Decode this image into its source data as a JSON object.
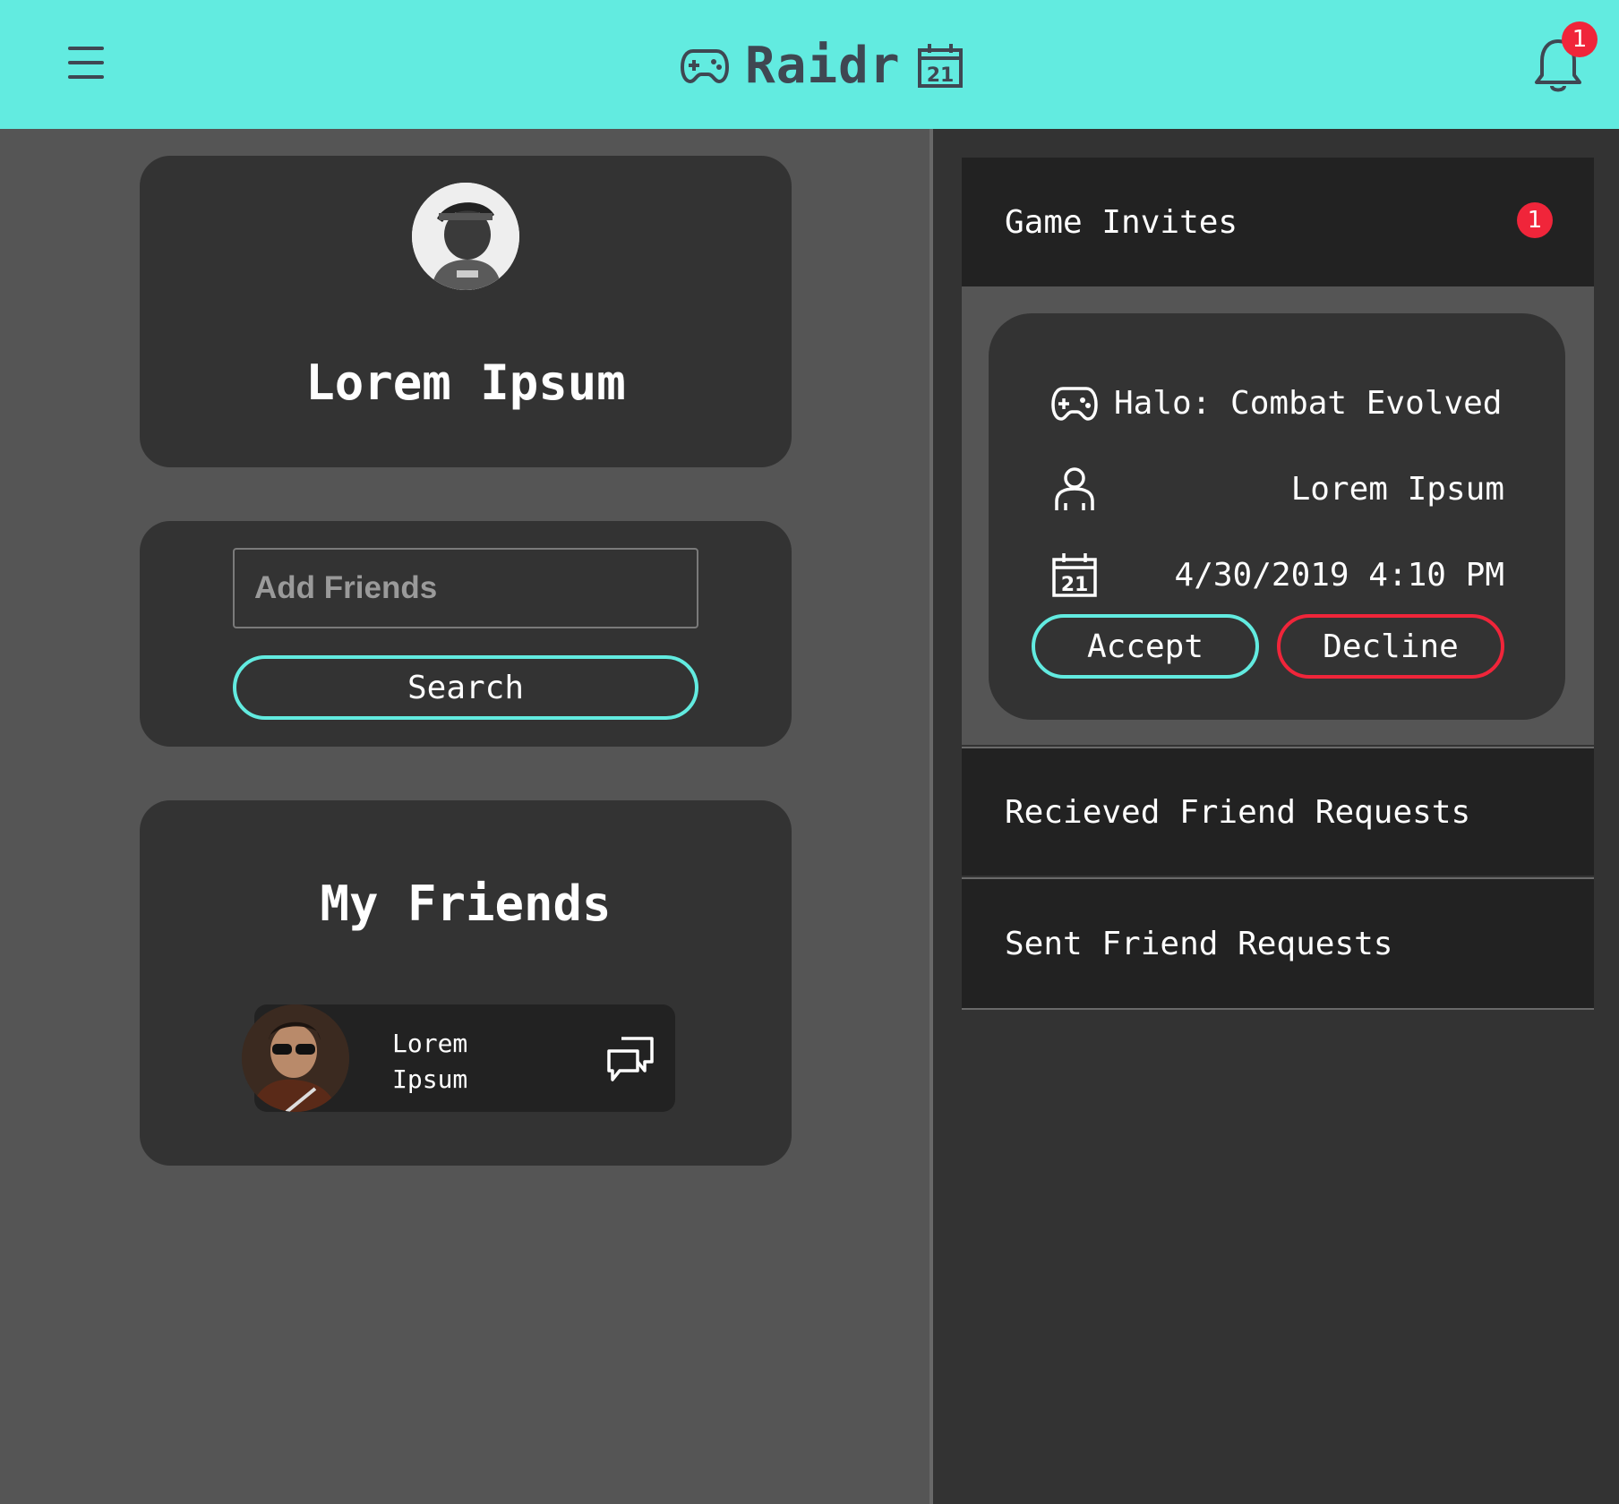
{
  "app": {
    "title": "Raidr",
    "accent_color": "#62ebe0",
    "alert_color": "#f0253a",
    "header_icons": [
      "gamepad-icon",
      "calendar-icon"
    ]
  },
  "topbar": {
    "menu_icon": "hamburger-menu-icon",
    "notifications": {
      "icon": "bell-icon",
      "count": "1"
    }
  },
  "profile": {
    "name": "Lorem Ipsum",
    "avatar": "user-avatar"
  },
  "add_friends": {
    "placeholder": "Add Friends",
    "value": "",
    "search_label": "Search"
  },
  "friends": {
    "title": "My Friends",
    "items": [
      {
        "first": "Lorem",
        "last": "Ipsum",
        "avatar": "friend-avatar",
        "action_icon": "chat-bubbles-icon"
      }
    ]
  },
  "game_invites": {
    "title": "Game Invites",
    "badge": "1",
    "invites": [
      {
        "game": "Halo: Combat Evolved",
        "host": "Lorem Ipsum",
        "datetime": "4/30/2019 4:10 PM",
        "accept_label": "Accept",
        "decline_label": "Decline"
      }
    ]
  },
  "received_requests": {
    "title": "Recieved Friend Requests"
  },
  "sent_requests": {
    "title": "Sent Friend Requests"
  }
}
